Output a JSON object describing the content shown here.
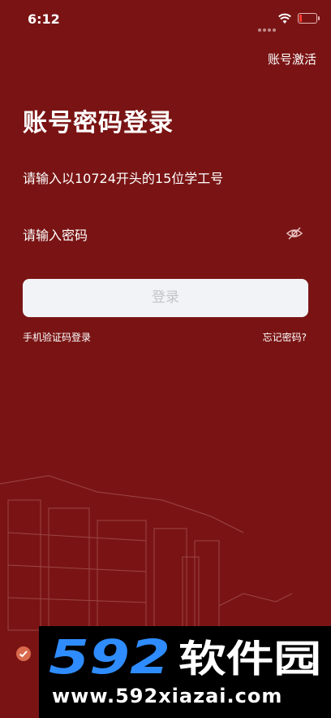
{
  "status": {
    "time": "6:12"
  },
  "header": {
    "activate_label": "账号激活"
  },
  "main": {
    "title": "账号密码登录",
    "account_placeholder": "请输入以10724开头的15位学工号",
    "password_placeholder": "请输入密码",
    "login_label": "登录",
    "sms_login_label": "手机验证码登录",
    "forgot_label": "忘记密码?"
  },
  "watermark": {
    "logo_text": "592软件园",
    "url": "www.592xiazai.com"
  },
  "colors": {
    "background": "#7a1414",
    "button_bg": "#f2f3f6",
    "button_text": "#c2c4c9",
    "watermark_blue": "#2f8cff"
  },
  "icons": {
    "wifi": "wifi-icon",
    "battery": "battery-low-icon",
    "eye": "eye-hidden-icon",
    "check": "check-circle-icon"
  }
}
